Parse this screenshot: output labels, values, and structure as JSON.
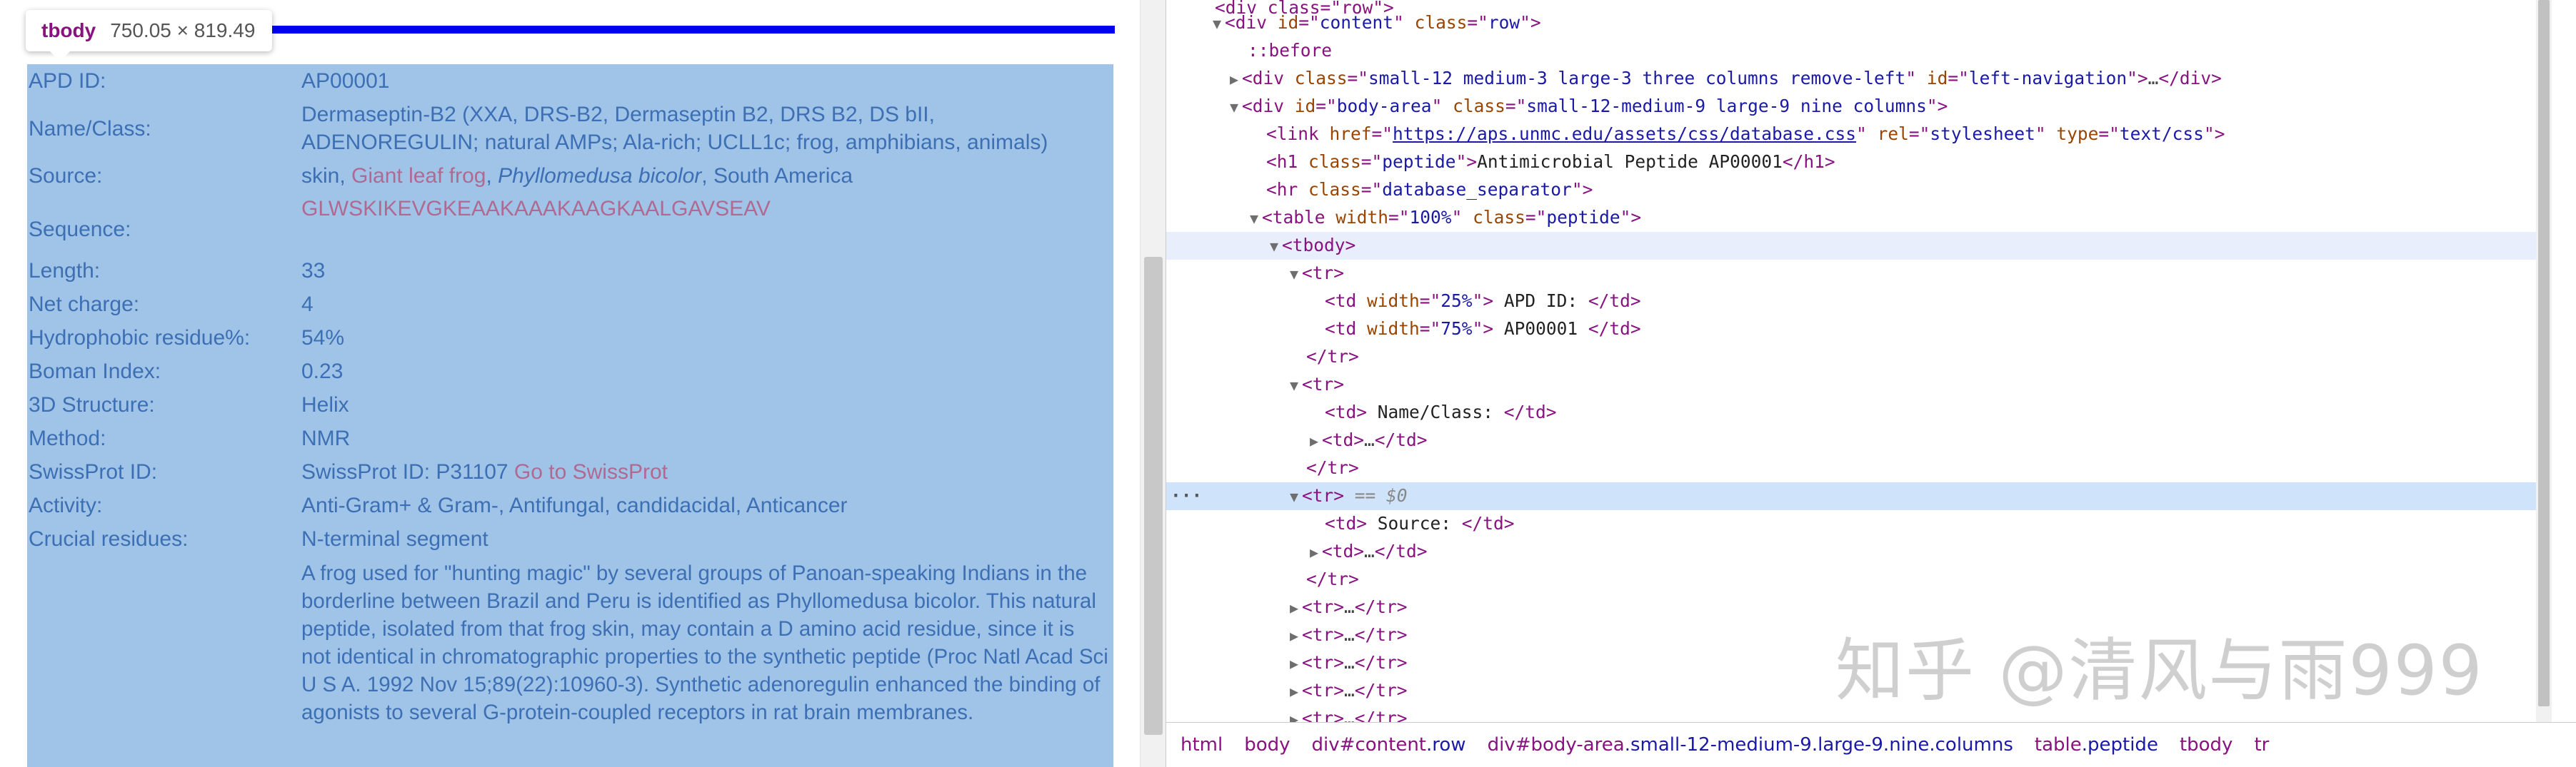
{
  "inspector_tooltip": {
    "tag": "tbody",
    "size": "750.05 × 819.49"
  },
  "peptide_table": {
    "rows": [
      {
        "label": "APD ID:",
        "value": "AP00001"
      },
      {
        "label": "Name/Class:",
        "value": "Dermaseptin-B2 (XXA, DRS-B2, Dermaseptin B2, DRS B2, DS bII, ADENOREGULIN; natural AMPs; Ala-rich; UCLL1c; frog, amphibians, animals)"
      },
      {
        "label": "Source:",
        "value_parts": [
          "skin, ",
          "Giant leaf frog",
          ", ",
          "Phyllomedusa bicolor",
          ", South America"
        ]
      },
      {
        "label": "Sequence:",
        "value": "GLWSKIKEVGKEAAKAAAKAAGKAALGAVSEAV"
      },
      {
        "label": "Length:",
        "value": "33"
      },
      {
        "label": "Net charge:",
        "value": "4"
      },
      {
        "label": "Hydrophobic residue%:",
        "value": "54%"
      },
      {
        "label": "Boman Index:",
        "value": "0.23"
      },
      {
        "label": "3D Structure:",
        "value": "Helix"
      },
      {
        "label": "Method:",
        "value": "NMR"
      },
      {
        "label": "SwissProt ID:",
        "value": "SwissProt ID: P31107",
        "link": "Go to SwissProt"
      },
      {
        "label": "Activity:",
        "value": "Anti-Gram+ & Gram-, Antifungal, candidacidal, Anticancer"
      },
      {
        "label": "Crucial residues:",
        "value": "N-terminal segment"
      },
      {
        "label": "",
        "value": "A frog used for \"hunting magic\" by several groups of Panoan-speaking Indians in the borderline between Brazil and Peru is identified as Phyllomedusa bicolor. This natural peptide, isolated from that frog skin, may contain a D amino acid residue, since it is not identical in chromatographic properties to the synthetic peptide (Proc Natl Acad Sci U S A. 1992 Nov 15;89(22):10960-3). Synthetic adenoregulin enhanced the binding of agonists to several G-protein-coupled receptors in rat brain membranes."
      }
    ]
  },
  "dom_tree": {
    "content_div": {
      "tag": "div",
      "id": "content",
      "class": "row"
    },
    "before": "::before",
    "left_nav": {
      "class": "small-12 medium-3 large-3 three columns remove-left",
      "id": "left-navigation"
    },
    "body_area": {
      "id": "body-area",
      "class": "small-12-medium-9 large-9 nine columns"
    },
    "link": {
      "href": "https://aps.unmc.edu/assets/css/database.css",
      "rel": "stylesheet",
      "type": "text/css"
    },
    "h1": {
      "class": "peptide",
      "text": "Antimicrobial Peptide AP00001"
    },
    "hr": {
      "class": "database_separator"
    },
    "table": {
      "width": "100%",
      "class": "peptide"
    },
    "td1": {
      "width": "25%",
      "text": " APD ID: "
    },
    "td2": {
      "width": "75%",
      "text": " AP00001 "
    },
    "td3": {
      "text": " Name/Class: "
    },
    "td5": {
      "text": " Source: "
    },
    "selected_marker": "== $0",
    "collapsed": "…"
  },
  "breadcrumbs": [
    {
      "tag": "html"
    },
    {
      "tag": "body"
    },
    {
      "tag": "div",
      "id": "#content",
      "cls": ".row"
    },
    {
      "tag": "div",
      "id": "#body-area",
      "cls": ".small-12-medium-9.large-9.nine.columns"
    },
    {
      "tag": "table",
      "cls": ".peptide"
    },
    {
      "tag": "tbody"
    },
    {
      "tag": "tr"
    }
  ],
  "watermark": "知乎 @清风与雨999",
  "colors": {
    "highlight": "#a0c4e8",
    "separator": "#0000f0",
    "label_text": "#3d6fb4",
    "link_text": "#b06a91",
    "selected_row": "#cfe3fb",
    "tag_color": "#881280",
    "attr_name": "#994500",
    "attr_value": "#1a1aa6"
  }
}
